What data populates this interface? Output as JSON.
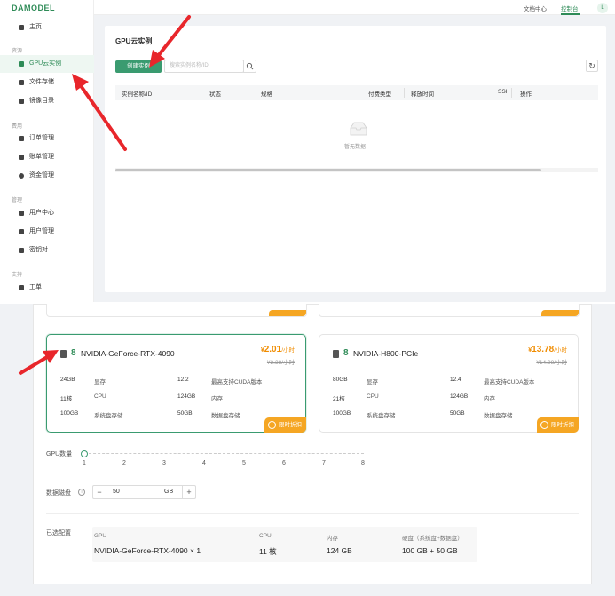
{
  "top": {
    "logo": "DAMODEL",
    "sidebar": {
      "home": "主页",
      "section_resources": "资源",
      "gpu_instances": "GPU云实例",
      "file_storage": "文件存储",
      "image_catalog": "镜像目录",
      "section_expenses": "费用",
      "order_management": "订单管理",
      "bill_management": "账单管理",
      "fund_management": "资金管理",
      "section_manage": "管理",
      "user_center": "用户中心",
      "user_management": "用户管理",
      "key_pair": "密钥对",
      "section_support": "支持",
      "ticket": "工单"
    },
    "header": {
      "docs": "文档中心",
      "console": "控制台",
      "avatar": "L"
    },
    "panel": {
      "title": "GPU云实例",
      "create_button": "创建实例",
      "search_placeholder": "搜索实例名称/ID",
      "columns": [
        "实例名称/ID",
        "状态",
        "规格",
        "付费类型",
        "释放时间",
        "SSH",
        "操作"
      ],
      "empty_text": "暂无数据"
    }
  },
  "bottom": {
    "cards": [
      {
        "count": "8",
        "name": "NVIDIA-GeForce-RTX-4090",
        "price_prefix": "¥",
        "price": "2.01",
        "price_unit": "/小时",
        "old_price": "¥2.38/小时",
        "specs": [
          {
            "value": "24GB",
            "label": "显存"
          },
          {
            "value": "12.2",
            "label": "最高支持CUDA版本"
          },
          {
            "value": "11核",
            "label": "CPU"
          },
          {
            "value": "124GB",
            "label": "内存"
          },
          {
            "value": "100GB",
            "label": "系统盘存储"
          },
          {
            "value": "50GB",
            "label": "数据盘存储"
          }
        ],
        "tag": "限时折扣"
      },
      {
        "count": "8",
        "name": "NVIDIA-H800-PCIe",
        "price_prefix": "¥",
        "price": "13.78",
        "price_unit": "/小时",
        "old_price": "¥14.98/小时",
        "specs": [
          {
            "value": "80GB",
            "label": "显存"
          },
          {
            "value": "12.4",
            "label": "最高支持CUDA版本"
          },
          {
            "value": "21核",
            "label": "CPU"
          },
          {
            "value": "124GB",
            "label": "内存"
          },
          {
            "value": "100GB",
            "label": "系统盘存储"
          },
          {
            "value": "50GB",
            "label": "数据盘存储"
          }
        ],
        "tag": "限时折扣"
      }
    ],
    "gpu_count_label": "GPU数量",
    "gpu_ticks": [
      "1",
      "2",
      "3",
      "4",
      "5",
      "6",
      "7",
      "8"
    ],
    "gpu_selected": 1,
    "data_disk_label": "数据磁盘",
    "data_disk_value": "50",
    "data_disk_unit": "GB",
    "stepper_minus": "−",
    "stepper_plus": "+",
    "selected_config_label": "已选配置",
    "summary": {
      "gpu_h": "GPU",
      "gpu_v": "NVIDIA-GeForce-RTX-4090 × 1",
      "cpu_h": "CPU",
      "cpu_v": "11 核",
      "mem_h": "内存",
      "mem_v": "124 GB",
      "disk_h": "硬盘（系统盘+数据盘）",
      "disk_v": "100 GB + 50 GB"
    }
  },
  "colors": {
    "brand": "#2e8b57",
    "button": "#3a9b70",
    "accent_orange": "#f5a623",
    "arrow": "#e8262b"
  }
}
